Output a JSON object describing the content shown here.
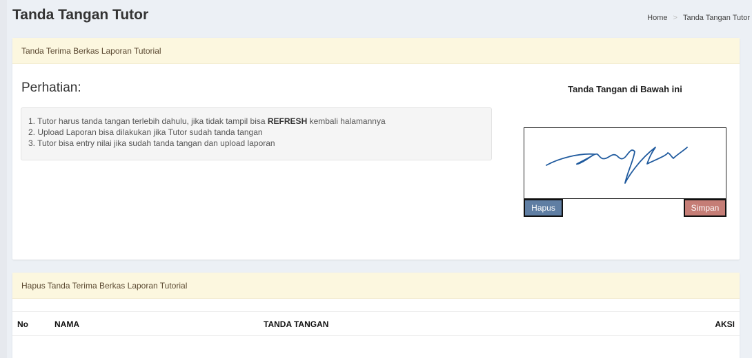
{
  "header": {
    "title": "Tanda Tangan Tutor",
    "breadcrumb": {
      "home": "Home",
      "separator": ">",
      "current": "Tanda Tangan Tutor"
    }
  },
  "receipt_box": {
    "heading": "Tanda Terima Berkas Laporan Tutorial",
    "notice_title": "Perhatian:",
    "notice_items": [
      {
        "pre": "1. Tutor harus tanda tangan terlebih dahulu, jika tidak tampil bisa ",
        "bold": "REFRESH",
        "post": " kembali halamannya"
      },
      {
        "pre": "2. Upload Laporan bisa dilakukan jika Tutor sudah tanda tangan",
        "bold": "",
        "post": ""
      },
      {
        "pre": "3. Tutor bisa entry nilai jika sudah tanda tangan dan upload laporan",
        "bold": "",
        "post": ""
      }
    ],
    "signature": {
      "title": "Tanda Tangan di Bawah ini",
      "clear_label": "Hapus",
      "save_label": "Simpan"
    }
  },
  "delete_box": {
    "heading": "Hapus Tanda Terima Berkas Laporan Tutorial",
    "columns": [
      "No",
      "NAMA",
      "TANDA TANGAN",
      "AKSI"
    ]
  },
  "colors": {
    "page_bg": "#ecf0f5",
    "box_header_bg": "#fcf7df",
    "hapus_button": "#5f7ea3",
    "simpan_button": "#c57d76",
    "signature_ink": "#1f5a9e"
  }
}
